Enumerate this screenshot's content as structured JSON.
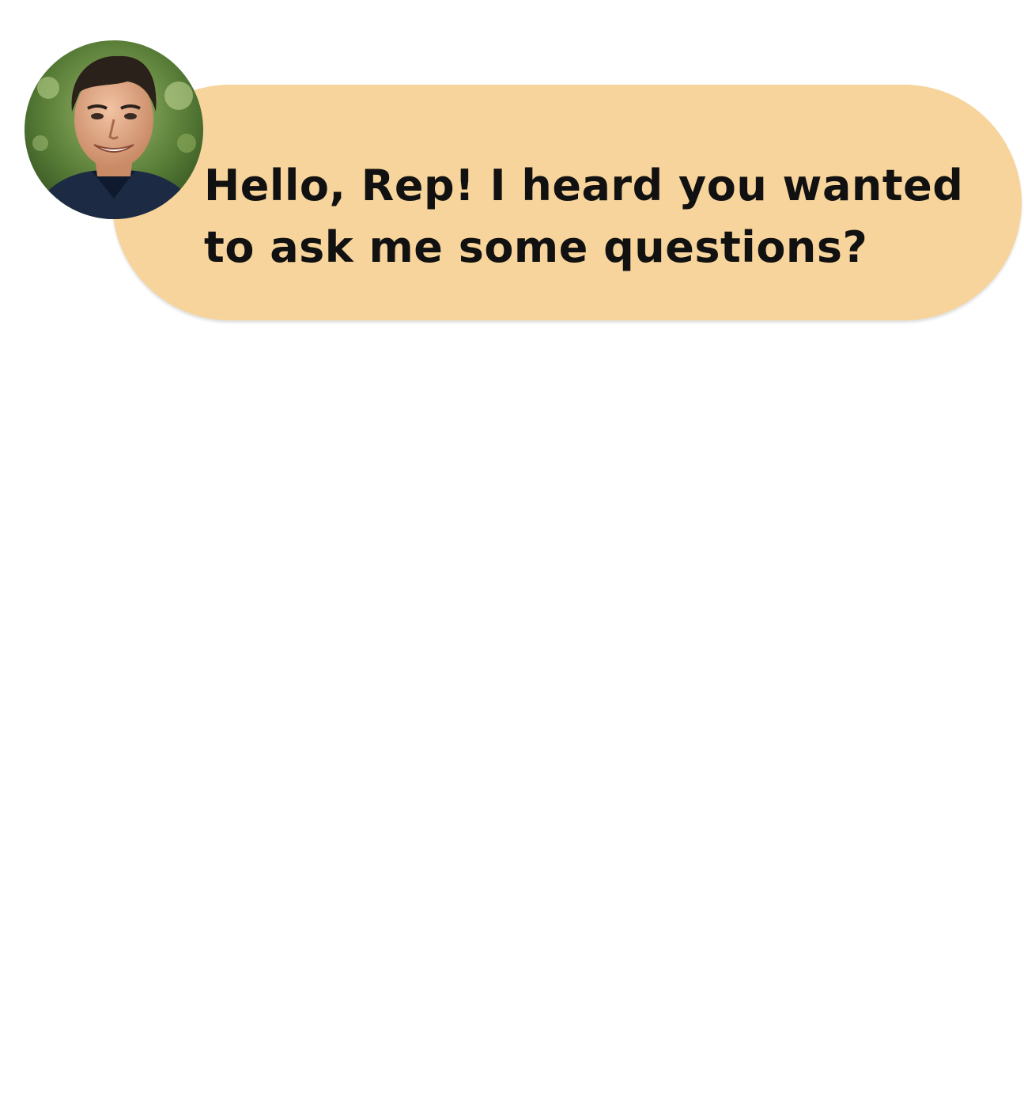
{
  "conversation": {
    "messages": [
      {
        "avatar_icon": "person-photo-avatar",
        "text": "Hello, Rep! I heard you wanted to ask me some questions?"
      }
    ]
  },
  "colors": {
    "bubble": "#f7d49b",
    "text": "#111111",
    "background": "#ffffff"
  }
}
